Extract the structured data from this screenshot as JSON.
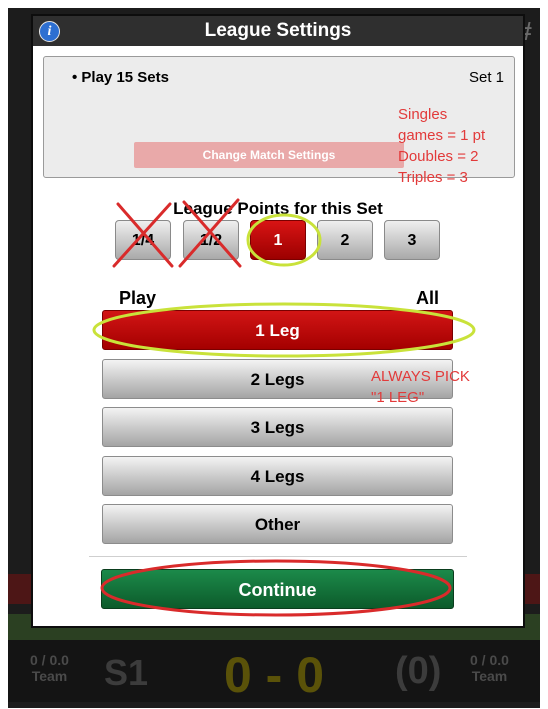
{
  "modal": {
    "title": "League Settings",
    "info_icon": "i",
    "match": {
      "label": "Play 15 Sets",
      "set": "Set 1",
      "change_button": "Change Match Settings"
    },
    "points_title": "League Points for this Set",
    "points_options": [
      "1/4",
      "1/2",
      "1",
      "2",
      "3"
    ],
    "selected_points": "1",
    "play_label": "Play",
    "all_label": "All",
    "legs": [
      "1 Leg",
      "2 Legs",
      "3 Legs",
      "4 Legs",
      "Other"
    ],
    "selected_leg": "1 Leg",
    "continue_button": "Continue"
  },
  "annotations": {
    "points_note": [
      "Singles",
      "games = 1 pt",
      "Doubles = 2",
      "Triples = 3"
    ],
    "leg_note": [
      "ALWAYS PICK",
      "\"1 LEG\""
    ]
  },
  "scoreboard": {
    "left_stat": "0 / 0.0",
    "left_team": "Team",
    "set": "S1",
    "score": "0 - 0",
    "pending": "(0)",
    "right_stat": "0 / 0.0",
    "right_team": "Team"
  },
  "background": {
    "hash_icon": "#"
  },
  "colors": {
    "header": "#2f2f2f",
    "selected_red": "#c40000",
    "continue_green": "#137a3c",
    "annotation_red": "#e23a3a",
    "highlight_green": "#c9e23a"
  }
}
